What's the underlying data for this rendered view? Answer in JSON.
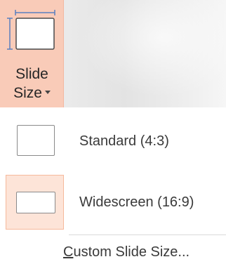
{
  "ribbon": {
    "slide_size_button": {
      "label_line1": "Slide",
      "label_line2": "Size",
      "icon": "slide-size-icon",
      "dropdown_icon": "caret-down-icon",
      "highlight_color": "#f9cbb8"
    }
  },
  "menu": {
    "items": [
      {
        "label": "Standard (4:3)",
        "icon": "standard-slide-icon",
        "selected": false
      },
      {
        "label": "Widescreen (16:9)",
        "icon": "widescreen-slide-icon",
        "selected": true
      }
    ],
    "custom": {
      "accelerator": "C",
      "rest": "ustom Slide Size..."
    },
    "selected_color": "#fde4d8",
    "selected_border_color": "#f6b99c"
  }
}
